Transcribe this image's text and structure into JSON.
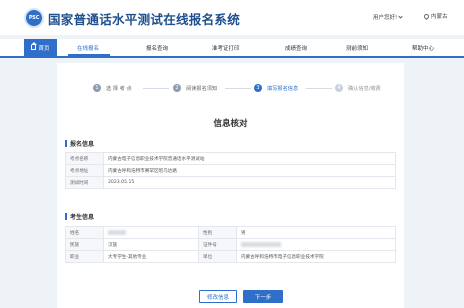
{
  "header": {
    "logo_text": "PSC",
    "system_title": "国家普通话水平测试在线报名系统",
    "user_greeting": "用户您好!",
    "region": "内蒙古"
  },
  "nav": {
    "home": "首页",
    "items": [
      "在线报名",
      "报名查询",
      "准考证打印",
      "成绩查询",
      "测前须知",
      "帮助中心"
    ],
    "active": "在线报名"
  },
  "steps": [
    {
      "num": "1",
      "label": "选 择 考 点",
      "state": "done"
    },
    {
      "num": "2",
      "label": "阅读报名须知",
      "state": "done"
    },
    {
      "num": "3",
      "label": "填写报名信息",
      "state": "current"
    },
    {
      "num": "4",
      "label": "确认信息/缴费",
      "state": "todo"
    }
  ],
  "page_title": "信息核对",
  "registration": {
    "section_title": "报名信息",
    "rows": [
      {
        "label": "考点名称",
        "value": "内蒙古电子信息职业技术学院普通话水平测试站"
      },
      {
        "label": "考点地址",
        "value": "内蒙古呼和浩特市赛罕区昭乌达路"
      },
      {
        "label": "测试时间",
        "value": "2023.05.15"
      }
    ]
  },
  "candidate": {
    "section_title": "考生信息",
    "rows": [
      {
        "l1": "姓名",
        "v1": "",
        "l2": "性别",
        "v2": "男"
      },
      {
        "l1": "民族",
        "v1": "汉族",
        "l2": "证件号",
        "v2": ""
      },
      {
        "l1": "职业",
        "v1": "大专学生-其他专业",
        "l2": "单位",
        "v2": "内蒙古呼和浩特市电子信息职业技术学院"
      }
    ]
  },
  "buttons": {
    "modify": "修改信息",
    "next": "下一步"
  },
  "colors": {
    "primary": "#2f6fc9",
    "background": "#eef3f8"
  }
}
